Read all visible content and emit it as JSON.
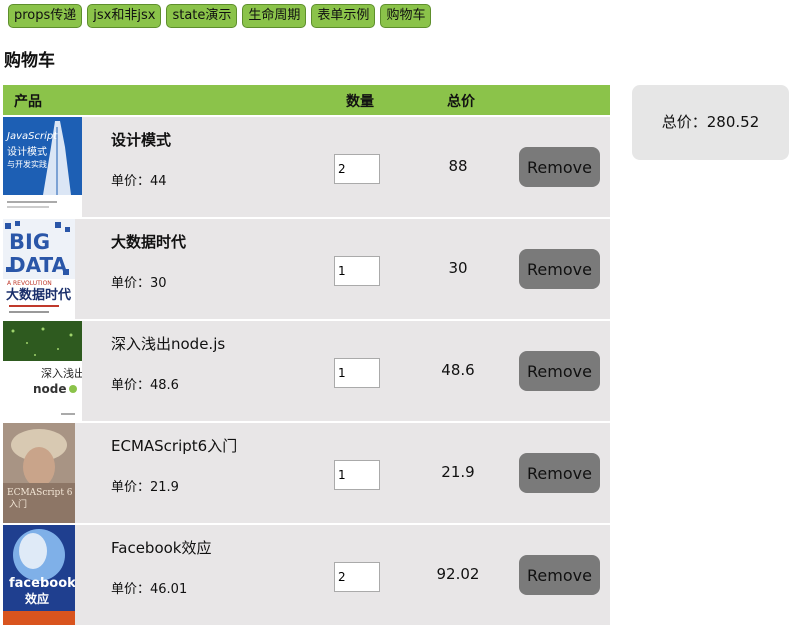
{
  "nav": {
    "tabs": [
      "props传递",
      "jsx和非jsx",
      "state演示",
      "生命周期",
      "表单示例",
      "购物车"
    ]
  },
  "page": {
    "title": "购物车"
  },
  "table": {
    "headers": {
      "product": "产品",
      "quantity": "数量",
      "total": "总价"
    }
  },
  "items": [
    {
      "name": "设计模式",
      "unit_price_text": "单价：44",
      "quantity": "2",
      "total": "88",
      "remove_label": "Remove",
      "cover": {
        "title_en": "JavaScript",
        "title_cn_1": "设计模式",
        "title_cn_2": "与开发实践"
      }
    },
    {
      "name": "大数据时代",
      "unit_price_text": "单价：30",
      "quantity": "1",
      "total": "30",
      "remove_label": "Remove",
      "cover": {
        "word1": "BIG",
        "word2": "DATA",
        "subtitle": "A REVOLUTION",
        "title_cn": "大数据时代"
      }
    },
    {
      "name": "深入浅出node.js",
      "unit_price_text": "单价：48.6",
      "quantity": "1",
      "total": "48.6",
      "remove_label": "Remove",
      "cover": {
        "title_cn": "深入浅出",
        "title_en": "node"
      }
    },
    {
      "name": "ECMAScript6入门",
      "unit_price_text": "单价：21.9",
      "quantity": "1",
      "total": "21.9",
      "remove_label": "Remove",
      "cover": {
        "title_en": "ECMAScript 6",
        "title_cn": "入门"
      }
    },
    {
      "name": "Facebook效应",
      "unit_price_text": "单价：46.01",
      "quantity": "2",
      "total": "92.02",
      "remove_label": "Remove",
      "cover": {
        "title_en": "facebook",
        "title_cn": "效应"
      }
    }
  ],
  "summary": {
    "total_text": "总价：280.52"
  },
  "colors": {
    "accent": "#8bc34a",
    "row_bg": "#e8e6e7",
    "button_bg": "#7a7a7a"
  }
}
